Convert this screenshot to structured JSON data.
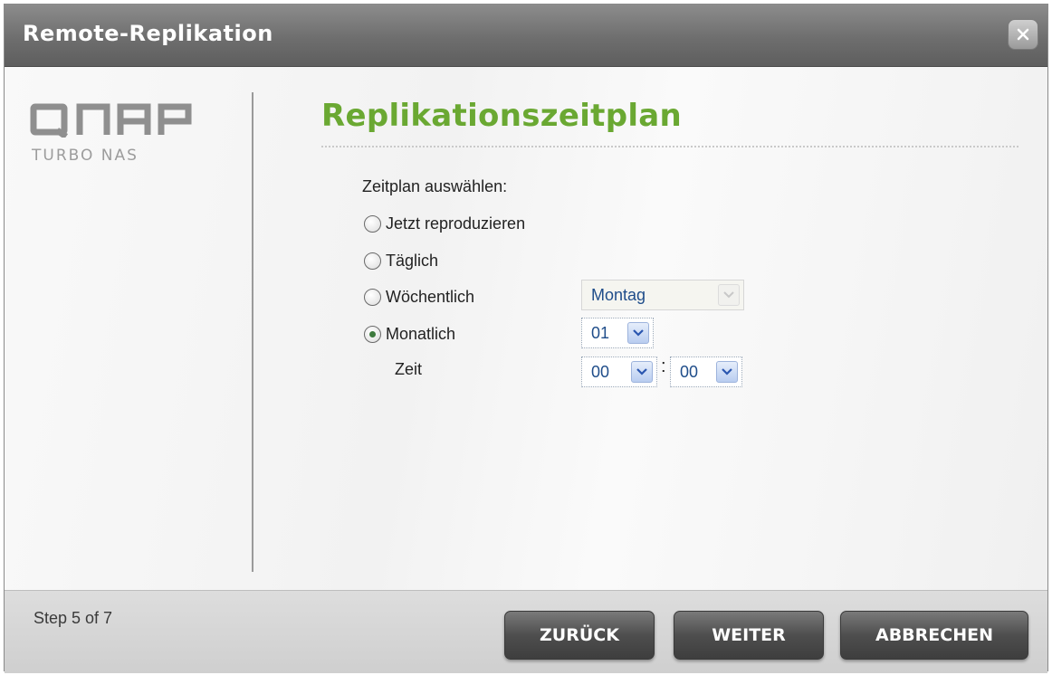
{
  "window": {
    "title": "Remote-Replikation"
  },
  "logo": {
    "brand": "QNAP",
    "subtitle": "Turbo NAS"
  },
  "main": {
    "heading": "Replikationszeitplan",
    "schedule_label": "Zeitplan auswählen:",
    "options": [
      {
        "label": "Jetzt reproduzieren",
        "checked": false
      },
      {
        "label": "Täglich",
        "checked": false
      },
      {
        "label": "Wöchentlich",
        "checked": false
      },
      {
        "label": "Monatlich",
        "checked": true
      }
    ],
    "weekday_select": {
      "value": "Montag",
      "enabled": false
    },
    "day_select": {
      "value": "01"
    },
    "time_label": "Zeit",
    "hour_select": {
      "value": "00"
    },
    "time_separator": ":",
    "minute_select": {
      "value": "00"
    }
  },
  "footer": {
    "step_text": "Step 5 of 7",
    "back_label": "ZURÜCK",
    "next_label": "WEITER",
    "cancel_label": "ABBRECHEN"
  },
  "colors": {
    "heading": "#6aa832",
    "titlebar": "#6e6e6e",
    "button": "#4e4e4e"
  },
  "icons": [
    "close-icon",
    "chevron-down-icon"
  ]
}
